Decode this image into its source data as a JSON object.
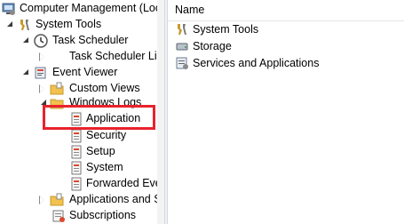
{
  "tree": {
    "root": {
      "label": "Computer Management (Local"
    },
    "items": [
      {
        "label": "System Tools"
      },
      {
        "label": "Task Scheduler"
      },
      {
        "label": "Task Scheduler Libra"
      },
      {
        "label": "Event Viewer"
      },
      {
        "label": "Custom Views"
      },
      {
        "label": "Windows Logs"
      },
      {
        "label": "Application"
      },
      {
        "label": "Security"
      },
      {
        "label": "Setup"
      },
      {
        "label": "System"
      },
      {
        "label": "Forwarded Event"
      },
      {
        "label": "Applications and Se"
      },
      {
        "label": "Subscriptions"
      }
    ]
  },
  "list": {
    "column_header": "Name",
    "items": [
      {
        "label": "System Tools"
      },
      {
        "label": "Storage"
      },
      {
        "label": "Services and Applications"
      }
    ]
  },
  "colors": {
    "highlight": "#e8222c",
    "folder": "#f2c14e"
  }
}
